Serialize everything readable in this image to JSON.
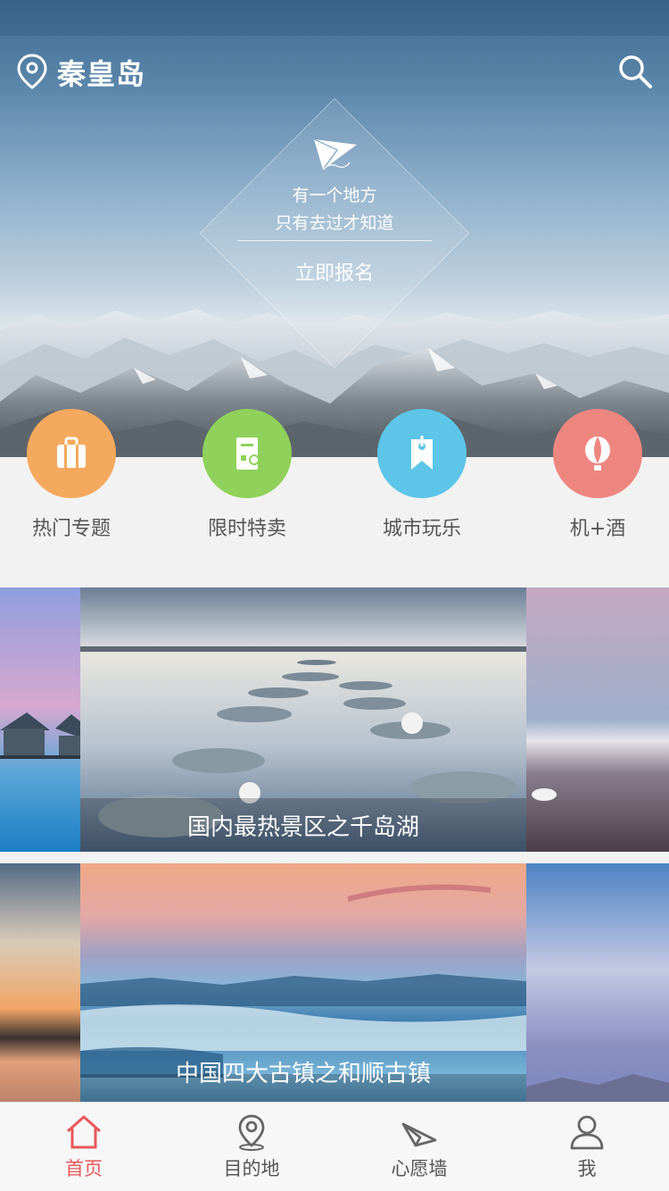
{
  "header": {
    "city": "秦皇岛"
  },
  "hero": {
    "line1": "有一个地方",
    "line2": "只有去过才知道",
    "cta": "立即报名"
  },
  "categories": [
    {
      "label": "热门专题",
      "icon": "suitcase-icon",
      "color": "#f5a95e"
    },
    {
      "label": "限时特卖",
      "icon": "ticket-icon",
      "color": "#8fd15a"
    },
    {
      "label": "城市玩乐",
      "icon": "bookmark-icon",
      "color": "#5cc5e8"
    },
    {
      "label": "机+酒",
      "icon": "balloon-icon",
      "color": "#ee8680"
    }
  ],
  "banners": [
    {
      "caption": "国内最热景区之千岛湖"
    },
    {
      "caption": "中国四大古镇之和顺古镇"
    }
  ],
  "tabbar": {
    "items": [
      {
        "label": "首页",
        "icon": "home-icon",
        "active": true
      },
      {
        "label": "目的地",
        "icon": "map-pin-icon",
        "active": false
      },
      {
        "label": "心愿墙",
        "icon": "paper-plane-icon",
        "active": false
      },
      {
        "label": "我",
        "icon": "user-icon",
        "active": false
      }
    ],
    "active_color": "#e8575a"
  }
}
